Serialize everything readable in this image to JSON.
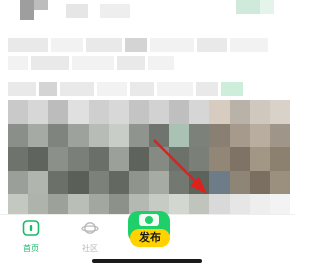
{
  "bottom_nav": {
    "home_label": "首页",
    "community_label": "社区",
    "publish_label": "发布",
    "home_icon": "home-icon",
    "community_icon": "planet-icon",
    "publish_icon": "camera-icon"
  },
  "colors": {
    "accent_green": "#19b96a",
    "publish_green": "#1fd06a",
    "publish_yellow": "#ffd200",
    "pointer_red": "#e0201a",
    "inactive_gray": "#b9b9b9"
  }
}
